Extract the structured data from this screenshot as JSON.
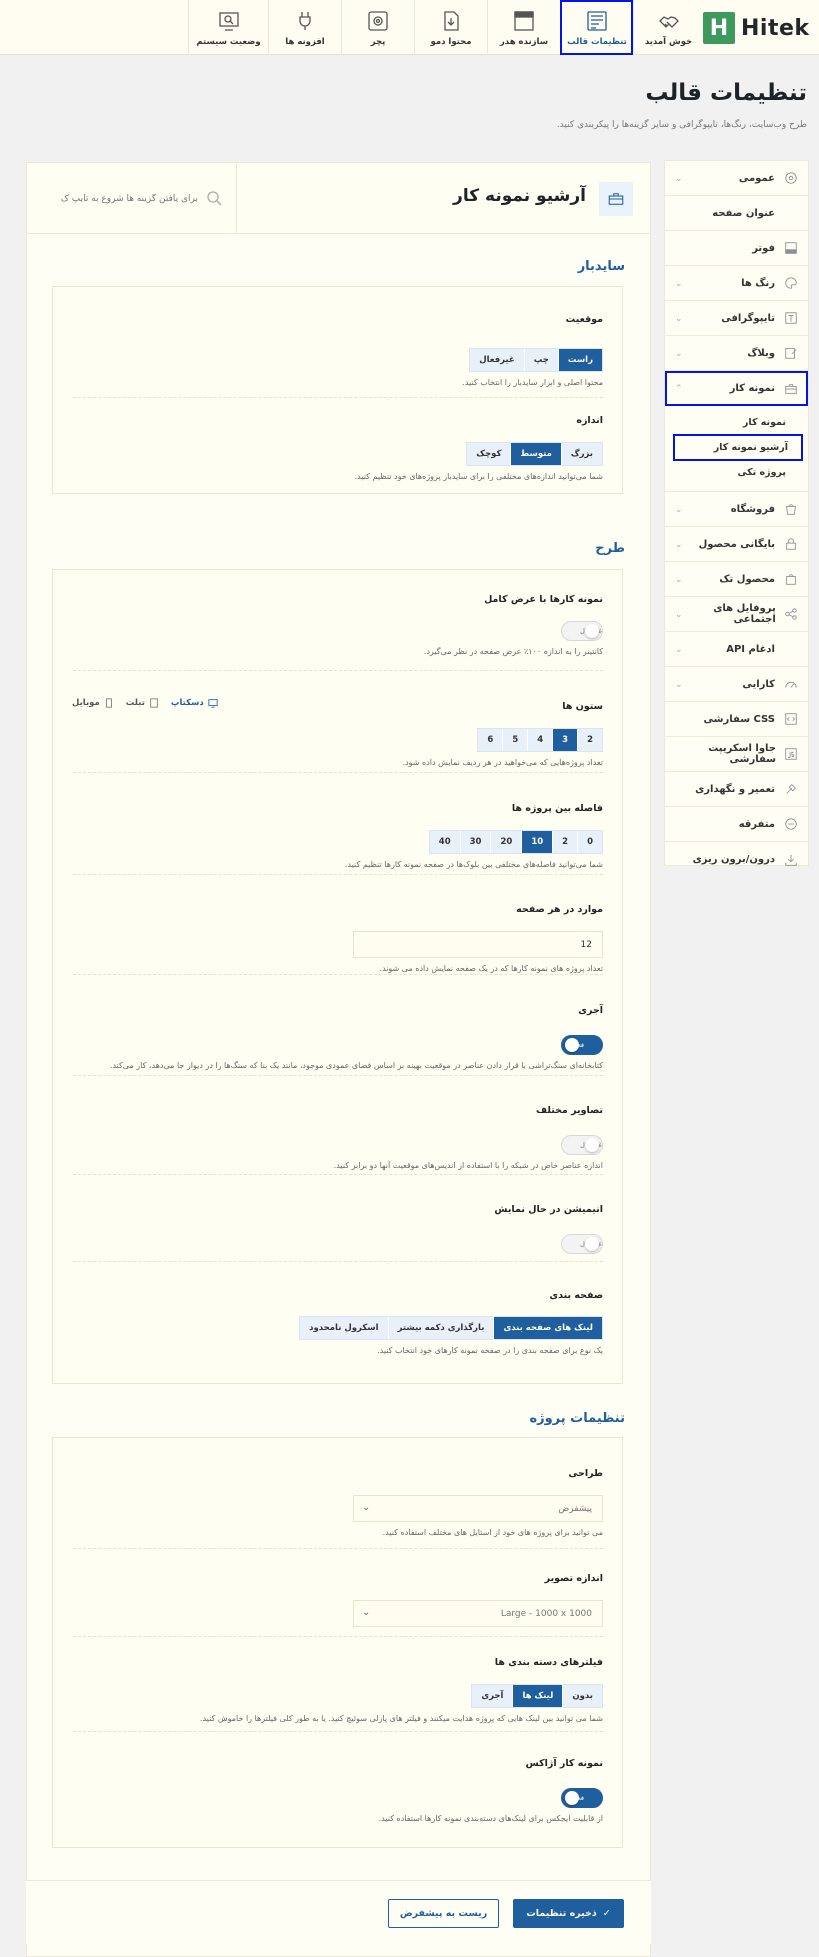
{
  "brand": {
    "logo_text": "Hitek",
    "logo_mark": "H"
  },
  "topnav": {
    "tabs": [
      {
        "label": "خوش آمدید",
        "icon": "handshake-icon"
      },
      {
        "label": "تنظیمات قالب",
        "icon": "settings-window-icon",
        "active": true
      },
      {
        "label": "سازنده هدر",
        "icon": "header-layout-icon"
      },
      {
        "label": "محتوا دمو",
        "icon": "import-document-icon"
      },
      {
        "label": "پچر",
        "icon": "gear-box-icon"
      },
      {
        "label": "افزونه ها",
        "icon": "plug-icon"
      },
      {
        "label": "وضعیت سیستم",
        "icon": "system-status-icon"
      }
    ]
  },
  "page": {
    "title": "تنظیمات قالب",
    "subtitle": "طرح وب‌سایت، رنگ‌ها، تایپوگرافی و سایر گزینه‌ها را پیکربندی کنید."
  },
  "sidebar": {
    "items": [
      {
        "label": "عمومی",
        "icon": "gear-circle-icon"
      },
      {
        "label": "عنوان صفحه",
        "icon": "title-icon"
      },
      {
        "label": "فوتر",
        "icon": "footer-icon"
      },
      {
        "label": "رنگ ها",
        "icon": "palette-icon"
      },
      {
        "label": "تایپوگرافی",
        "icon": "typography-icon"
      },
      {
        "label": "وبلاگ",
        "icon": "blog-edit-icon"
      },
      {
        "label": "نمونه کار",
        "icon": "briefcase-icon",
        "open": true
      },
      {
        "label": "فروشگاه",
        "icon": "shop-bag-icon"
      },
      {
        "label": "بایگانی محصول",
        "icon": "archive-lock-icon"
      },
      {
        "label": "محصول تک",
        "icon": "product-bag-icon"
      },
      {
        "label": "پروفایل های اجتماعی",
        "icon": "share-icon"
      },
      {
        "label": "ادغام API",
        "icon": "api-icon"
      },
      {
        "label": "کارایی",
        "icon": "speed-gauge-icon"
      },
      {
        "label": "CSS سفارشی",
        "icon": "css-icon"
      },
      {
        "label": "جاوا اسکریپت سفارشی",
        "icon": "javascript-icon"
      },
      {
        "label": "تعمیر و نگهداری",
        "icon": "maintenance-tools-icon"
      },
      {
        "label": "متفرقه",
        "icon": "misc-circle-icon"
      },
      {
        "label": "درون/برون ریزی",
        "icon": "import-export-icon"
      }
    ],
    "subitems": [
      {
        "label": "نمونه کار"
      },
      {
        "label": "آرشیو نمونه کار",
        "current": true
      },
      {
        "label": "پروژه تکی"
      }
    ]
  },
  "main": {
    "title": "آرشیو نمونه کار",
    "search_placeholder": "برای یافتن گزینه ها شروع به تایپ ک",
    "sections": {
      "sidebar": "سایدبار",
      "layout": "طرح",
      "project": "تنظیمات پروژه"
    }
  },
  "fields": {
    "position": {
      "label": "موقعیت",
      "options": [
        "غیرفعال",
        "چپ",
        "راست"
      ],
      "selected": "راست",
      "desc": "محتوا اصلی و ابزار سایدبار را انتخاب کنید."
    },
    "size": {
      "label": "اندازه",
      "options": [
        "کوچک",
        "متوسط",
        "بزرگ"
      ],
      "selected": "متوسط",
      "desc": "شما می‌توانید اندازه‌های مختلفی را برای سایدبار پروژه‌های خود تنظیم کنید."
    },
    "fullwidth": {
      "label": "نمونه کارها با عرض کامل",
      "state": "غیرفعال",
      "desc": "کانتینر را به اندازه ۱۰۰٪ عرض صفحه در نظر می‌گیرد."
    },
    "columns": {
      "label": "ستون ها",
      "options": [
        "2",
        "3",
        "4",
        "5",
        "6"
      ],
      "selected": "3",
      "desc": "تعداد پروژه‌هایی که می‌خواهید در هر ردیف نمایش داده شود.",
      "devices": [
        "دسکتاپ",
        "تبلت",
        "موبایل"
      ],
      "device_selected": "دسکتاپ"
    },
    "spacing": {
      "label": "فاصله بین پروژه ها",
      "options": [
        "0",
        "2",
        "10",
        "20",
        "30",
        "40"
      ],
      "selected": "10",
      "desc": "شما می‌توانید فاصله‌های مختلفی بین بلوک‌ها در صفحه نمونه کارها تنظیم کنید."
    },
    "per_page": {
      "label": "موارد در هر صفحه",
      "value": "12",
      "desc": "تعداد پروژه های نمونه کارها که در یک صفحه نمایش داده می شوند."
    },
    "masonry": {
      "label": "آجری",
      "state": "فعال",
      "desc": "کتابخانه‌ای سنگ‌تراشی با قرار دادن عناصر در موقعیت بهینه بر اساس فضای عمودی موجود، مانند یک بنا که سنگ‌ها را در دیوار جا می‌دهد، کار می‌کند."
    },
    "mixed_images": {
      "label": "تصاویر مختلف",
      "state": "غیرفعال",
      "desc": "اندازه عناصر خاص در شبکه را با استفاده از اندیس‌های موقعیت آنها دو برابر کنید."
    },
    "animation": {
      "label": "انیمیشن در حال نمایش",
      "state": "غیرفعال"
    },
    "pagination": {
      "label": "صفحه بندی",
      "options": [
        "لینک های صفحه بندی",
        "بارگذاری دکمه بیشتر",
        "اسکرول نامحدود"
      ],
      "selected": "لینک های صفحه بندی",
      "desc": "یک نوع برای صفحه بندی را در صفحه نمونه کارهای خود انتخاب کنید."
    },
    "design": {
      "label": "طراحی",
      "value": "پیشفرض",
      "desc": "می توانید برای پروژه های خود از استایل های مختلف استفاده کنید."
    },
    "image_size": {
      "label": "اندازه تصویر",
      "value": "Large - 1000 x 1000"
    },
    "filters": {
      "label": "فیلترهای دسته بندی ها",
      "options": [
        "بدون",
        "لینک ها",
        "آجری"
      ],
      "selected": "لینک ها",
      "desc": "شما می توانید بین لینک هایی که پروژه هدایت میکنند و فیلتر های پازلی سوئیچ کنید. یا به طور کلی فیلترها را خاموش کنید."
    },
    "ajax": {
      "label": "نمونه کار آژاکس",
      "state": "فعال",
      "desc": "از قابلیت ایجکس برای لینک‌های دسته‌بندی نمونه کارها استفاده کنید."
    }
  },
  "footer": {
    "save": "ذخیره تنظیمات",
    "reset": "ریست به پیشفرض"
  },
  "colors": {
    "accent": "#1f5f9e",
    "brand_green": "#3d9a5c",
    "highlight": "#0015e6"
  }
}
